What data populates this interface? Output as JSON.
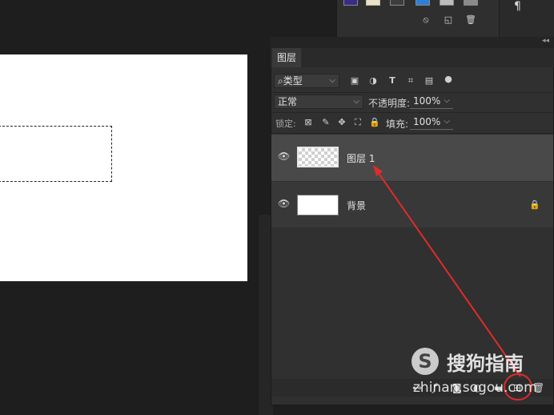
{
  "colors": {
    "background": "#1e1e1e",
    "panel": "#303030",
    "selected_layer": "#494949",
    "annotation_arrow": "#e02b2b",
    "document": "#ffffff"
  },
  "top_panel": {
    "icons": [
      "circle-slash-icon",
      "new-page-icon",
      "trash-icon"
    ],
    "paragraph_symbol": "¶"
  },
  "layers_panel": {
    "collapse_symbol": "◂◂",
    "tab_label": "图层",
    "filter": {
      "search_symbol": "⌕",
      "kind_label": "类型",
      "filter_icons": [
        "image-filter-icon",
        "adjustment-filter-icon",
        "type-filter-icon",
        "shape-filter-icon",
        "smart-object-filter-icon",
        "filter-toggle-icon"
      ]
    },
    "blend_mode": "正常",
    "opacity_label": "不透明度:",
    "opacity_value": "100%",
    "lock_label": "锁定:",
    "fill_label": "填充:",
    "fill_value": "100%",
    "layers": [
      {
        "name": "图层 1",
        "selected": true,
        "visible": true,
        "transparent_thumbnail": true
      },
      {
        "name": "背景",
        "selected": false,
        "visible": true,
        "locked": true
      }
    ],
    "bottom_icons": [
      "link-layers-icon",
      "fx-icon",
      "mask-icon",
      "adjustment-icon",
      "group-icon",
      "new-layer-icon",
      "delete-layer-icon"
    ]
  },
  "watermark": {
    "logo_letter": "S",
    "name": "搜狗指南",
    "url": "zhinan.sogou.com"
  }
}
